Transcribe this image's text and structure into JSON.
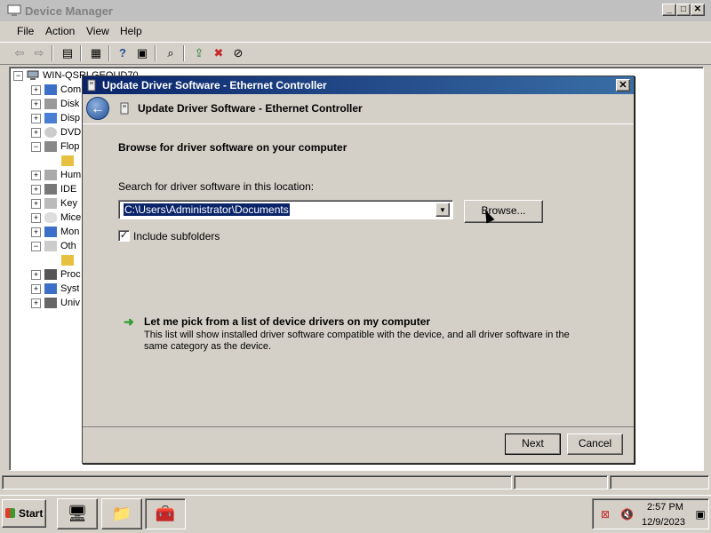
{
  "device_manager": {
    "title": "Device Manager",
    "menu": [
      "File",
      "Action",
      "View",
      "Help"
    ],
    "tree": {
      "root": "WIN-QSRLGEOUD70",
      "items": [
        "Com",
        "Disk",
        "Disp",
        "DVD",
        "Flop",
        "",
        "Hum",
        "IDE",
        "Key",
        "Mice",
        "Mon",
        "Oth",
        "",
        "Proc",
        "Syst",
        "Univ"
      ]
    }
  },
  "dialog": {
    "title": "Update Driver Software - Ethernet Controller",
    "header_title": "Update Driver Software - Ethernet Controller",
    "heading": "Browse for driver software on your computer",
    "search_label": "Search for driver software in this location:",
    "path_value": "C:\\Users\\Administrator\\Documents",
    "browse_label": "Browse...",
    "include_subfolders_label": "Include subfolders",
    "include_subfolders_checked": true,
    "pick_link": "Let me pick from a list of device drivers on my computer",
    "pick_description": "This list will show installed driver software compatible with the device, and all driver software in the same category as the device.",
    "next_label": "Next",
    "cancel_label": "Cancel"
  },
  "taskbar": {
    "start_label": "Start",
    "clock_time": "2:57 PM",
    "clock_date": "12/9/2023"
  },
  "icons": {
    "check_mark": "✓",
    "pick_arrow": "➜",
    "back_arrow": "←",
    "close_x": "✕"
  },
  "colors": {
    "dialog_title_start": "#0a246a",
    "dialog_title_end": "#3a6ea5",
    "selection": "#0a246a",
    "pick_arrow": "#2e9b2e"
  }
}
